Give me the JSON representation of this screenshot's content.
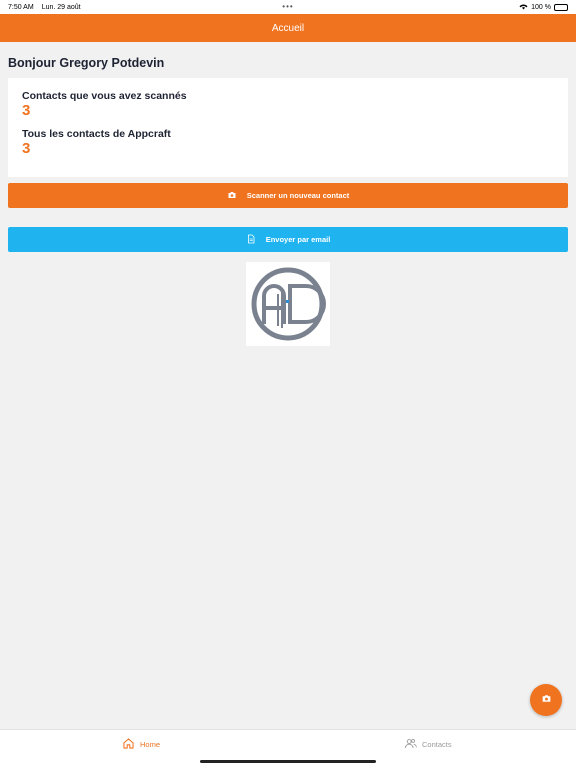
{
  "status": {
    "time": "7:50 AM",
    "date": "Lun. 29 août",
    "dots": "•••",
    "battery": "100 %"
  },
  "nav": {
    "title": "Accueil"
  },
  "greeting": "Bonjour Gregory Potdevin",
  "stats": {
    "scanned_label": "Contacts que vous avez scannés",
    "scanned_value": "3",
    "all_label": "Tous les contacts de Appcraft",
    "all_value": "3"
  },
  "actions": {
    "scan_label": "Scanner un nouveau contact",
    "email_label": "Envoyer par email"
  },
  "tabs": [
    {
      "label": "Home",
      "icon": "home-icon",
      "active": true
    },
    {
      "label": "Contacts",
      "icon": "contacts-icon",
      "active": false
    }
  ],
  "colors": {
    "accent": "#f07320",
    "email": "#1fb4f0",
    "text": "#1d2333",
    "background": "#f1f1f1"
  }
}
